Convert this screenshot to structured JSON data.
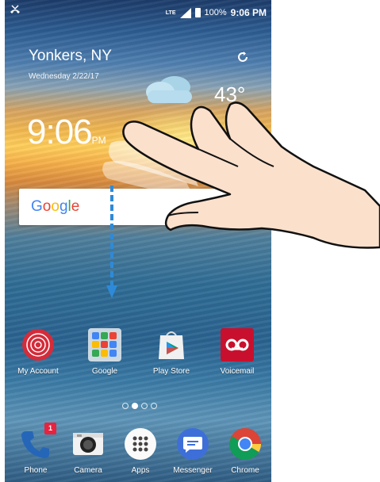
{
  "status_bar": {
    "network": "LTE",
    "battery": "100%",
    "time": "9:06 PM",
    "left_icon": "missed-call-icon"
  },
  "weather": {
    "city": "Yonkers, NY",
    "date": "Wednesday 2/22/17",
    "temp": "43°",
    "clock_time": "9:06",
    "clock_ampm": "PM",
    "refresh_icon": "refresh-icon",
    "condition_icon": "cloud-icon"
  },
  "search": {
    "logo_parts": [
      "G",
      "o",
      "o",
      "g",
      "l",
      "e"
    ]
  },
  "home_apps": [
    {
      "label": "My Account",
      "icon": "my-account-icon"
    },
    {
      "label": "Google",
      "icon": "google-folder-icon"
    },
    {
      "label": "Play Store",
      "icon": "play-store-icon"
    },
    {
      "label": "Voicemail",
      "icon": "voicemail-icon"
    }
  ],
  "page_indicator": {
    "total": 4,
    "active": 2
  },
  "dock_apps": [
    {
      "label": "Phone",
      "icon": "phone-icon",
      "badge": "1"
    },
    {
      "label": "Camera",
      "icon": "camera-icon"
    },
    {
      "label": "Apps",
      "icon": "apps-grid-icon"
    },
    {
      "label": "Messenger",
      "icon": "messenger-icon"
    },
    {
      "label": "Chrome",
      "icon": "chrome-icon"
    }
  ],
  "gesture": {
    "type": "two-finger swipe down",
    "arrow_color": "#2e8ad8"
  }
}
